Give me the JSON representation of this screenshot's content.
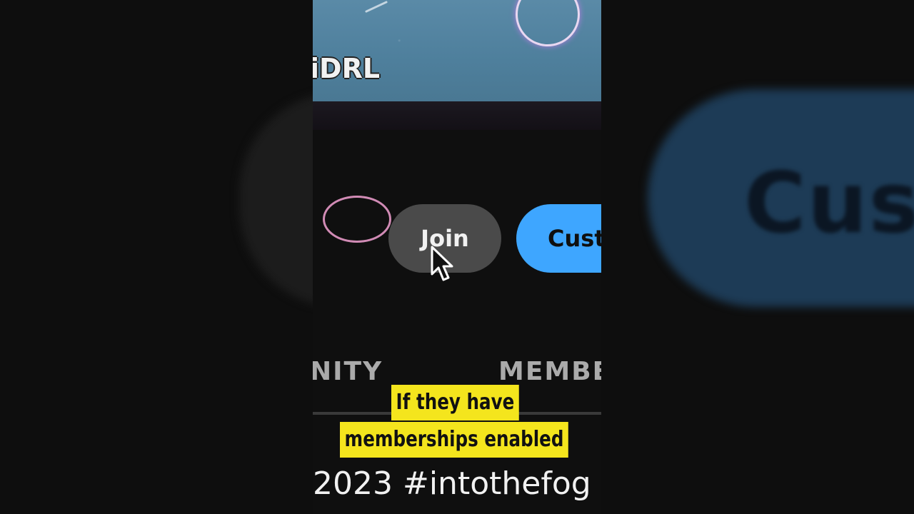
{
  "banner": {
    "channel_text": "iDRL"
  },
  "buttons": {
    "join_label": "Join",
    "customize_label": "Cust"
  },
  "tabs": [
    "NITY",
    "MEMBE"
  ],
  "description": {
    "text": "2023 #intothefog"
  },
  "caption": {
    "line1": "If they have",
    "line2": "memberships enabled"
  },
  "background_right": {
    "text": "Cust"
  },
  "colors": {
    "caption_bg": "#f4e51d",
    "join_bg": "#4a4a4a",
    "customize_bg": "#3ea6ff"
  },
  "icons": [
    "mouse-pointer-icon"
  ]
}
